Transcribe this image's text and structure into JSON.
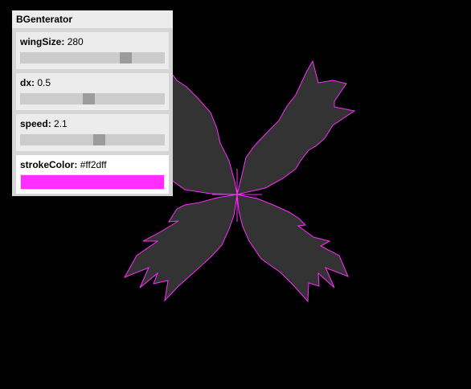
{
  "panel": {
    "title": "BGenterator",
    "controls": [
      {
        "name": "wingSize",
        "value": "280",
        "fraction": 0.75
      },
      {
        "name": "dx",
        "value": "0.5",
        "fraction": 0.47
      },
      {
        "name": "speed",
        "value": "2.1",
        "fraction": 0.55
      }
    ],
    "color": {
      "name": "strokeColor",
      "value": "#ff2dff"
    }
  },
  "canvas": {
    "background": "#000000",
    "fill": "#333333",
    "stroke": "#ff2dff"
  }
}
